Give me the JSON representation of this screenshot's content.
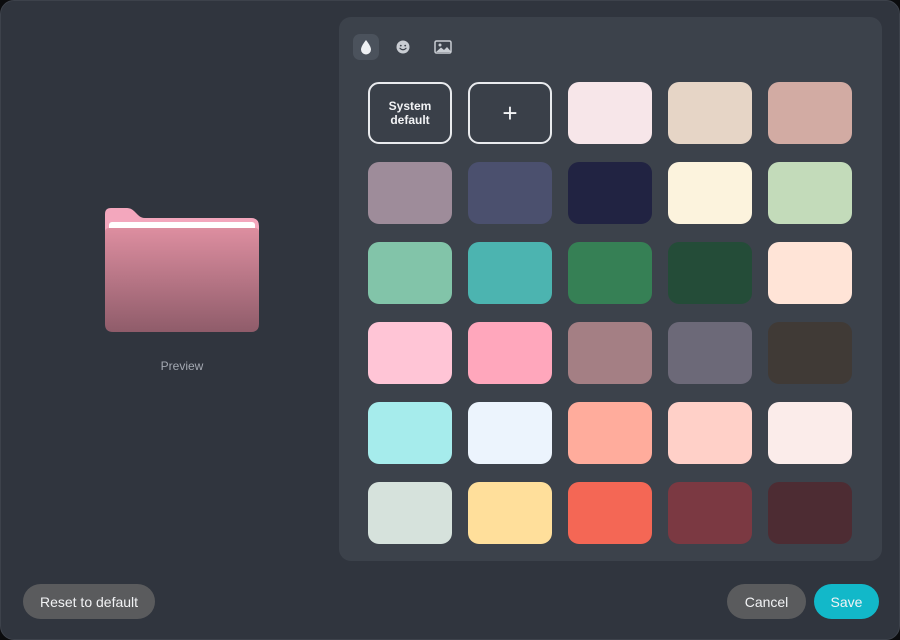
{
  "preview": {
    "label": "Preview",
    "folder_colors": {
      "tab": "#f3a7bd",
      "paper": "#ffffff",
      "top": "#dd8ea0",
      "bottom": "#8f5c6a"
    }
  },
  "tabs": [
    {
      "icon": "droplet-icon",
      "active": true
    },
    {
      "icon": "smiley-icon",
      "active": false
    },
    {
      "icon": "image-icon",
      "active": false
    }
  ],
  "swatches": {
    "system_default_label": "System default",
    "add_label": "+",
    "colors": [
      "#f7e6e9",
      "#e6d5c6",
      "#d2aba3",
      "#9e8c9a",
      "#4b506e",
      "#212342",
      "#fcf3dd",
      "#c3dbba",
      "#82c4a9",
      "#4cb4b0",
      "#368055",
      "#244c38",
      "#ffe4d7",
      "#ffc5d6",
      "#ffa7bc",
      "#a47f84",
      "#6c6978",
      "#403a36",
      "#a6ecec",
      "#ecf4fd",
      "#ffac9c",
      "#ffd0c8",
      "#fbecea",
      "#d6e2dc",
      "#ffdf9b",
      "#f46755",
      "#7b3942",
      "#4d2c33"
    ]
  },
  "buttons": {
    "reset": "Reset to default",
    "cancel": "Cancel",
    "save": "Save"
  }
}
